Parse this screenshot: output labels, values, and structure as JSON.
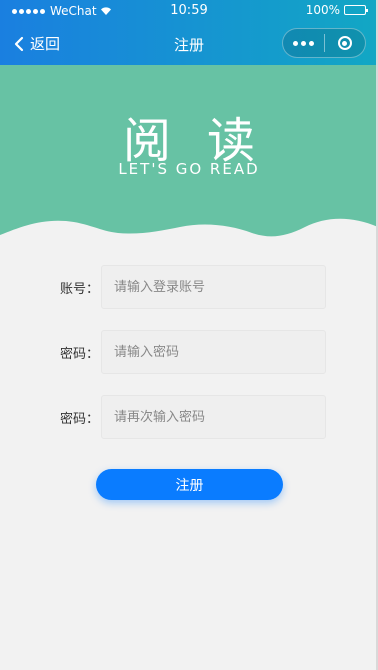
{
  "status_bar": {
    "carrier": "WeChat",
    "time": "10:59",
    "battery_label": "100%",
    "battery_level": 1.0
  },
  "navbar": {
    "back_label": "返回",
    "title": "注册"
  },
  "banner": {
    "title": "阅读",
    "subtitle": "LET'S GO READ",
    "background_color": "#67c2a4"
  },
  "form": {
    "fields": [
      {
        "label": "账号：",
        "placeholder": "请输入登录账号",
        "value": ""
      },
      {
        "label": "密码：",
        "placeholder": "请输入密码",
        "value": ""
      },
      {
        "label": "密码：",
        "placeholder": "请再次输入密码",
        "value": ""
      }
    ],
    "submit_label": "注册"
  },
  "colors": {
    "nav_gradient_start": "#1a7fe0",
    "nav_gradient_end": "#12a7c4",
    "button": "#0a7cff",
    "page_background": "#f2f2f2"
  }
}
